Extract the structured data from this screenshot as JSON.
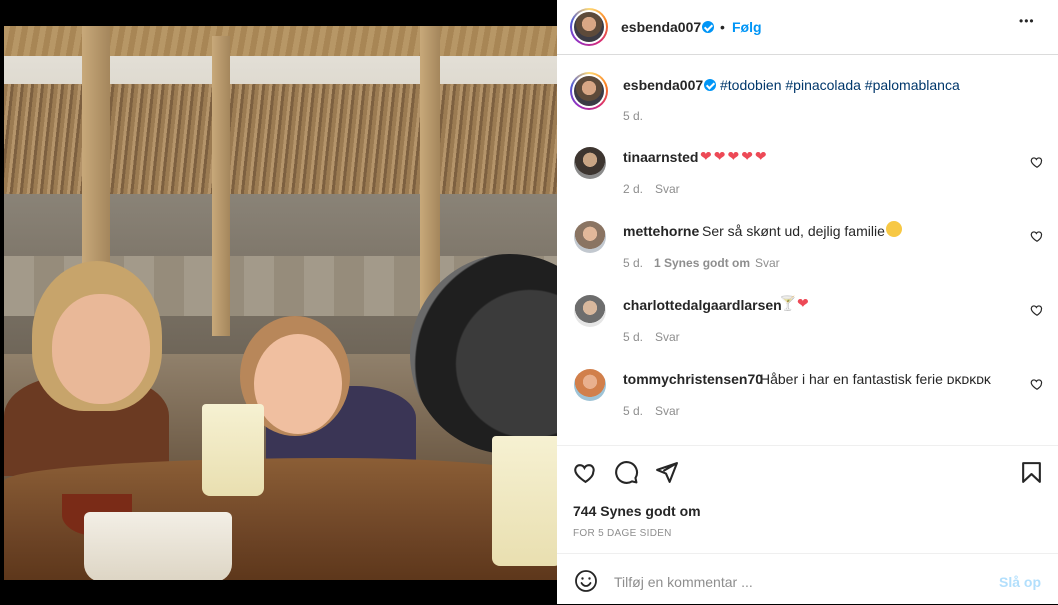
{
  "post": {
    "username": "esbenda007",
    "follow_label": "Følg",
    "separator": "•",
    "more_label": "•••"
  },
  "caption": {
    "username": "esbenda007",
    "hashtags": "#todobien #pinacolada #palomablanca",
    "time": "5 d."
  },
  "comments": [
    {
      "username": "tinaarnsted",
      "text": "",
      "hearts": 5,
      "time": "2 d.",
      "likes": "",
      "reply": "Svar"
    },
    {
      "username": "mettehorne",
      "text": "Ser så skønt ud, dejlig familie",
      "time": "5 d.",
      "likes": "1 Synes godt om",
      "reply": "Svar"
    },
    {
      "username": "charlottedalgaardlarsen",
      "text": "",
      "time": "5 d.",
      "likes": "",
      "reply": "Svar"
    },
    {
      "username": "tommychristensen70",
      "text": "Håber i har en fantastisk ferie ᴅᴋᴅᴋᴅᴋ",
      "time": "5 d.",
      "likes": "",
      "reply": "Svar"
    }
  ],
  "actions": {
    "likes": "744 Synes godt om",
    "date": "FOR 5 DAGE SIDEN"
  },
  "comment_box": {
    "placeholder": "Tilføj en kommentar ...",
    "post_label": "Slå op"
  },
  "colors": {
    "link": "#0095f6",
    "hashtag": "#00376b",
    "heart": "#ed4956",
    "muted": "#8e8e8e"
  }
}
